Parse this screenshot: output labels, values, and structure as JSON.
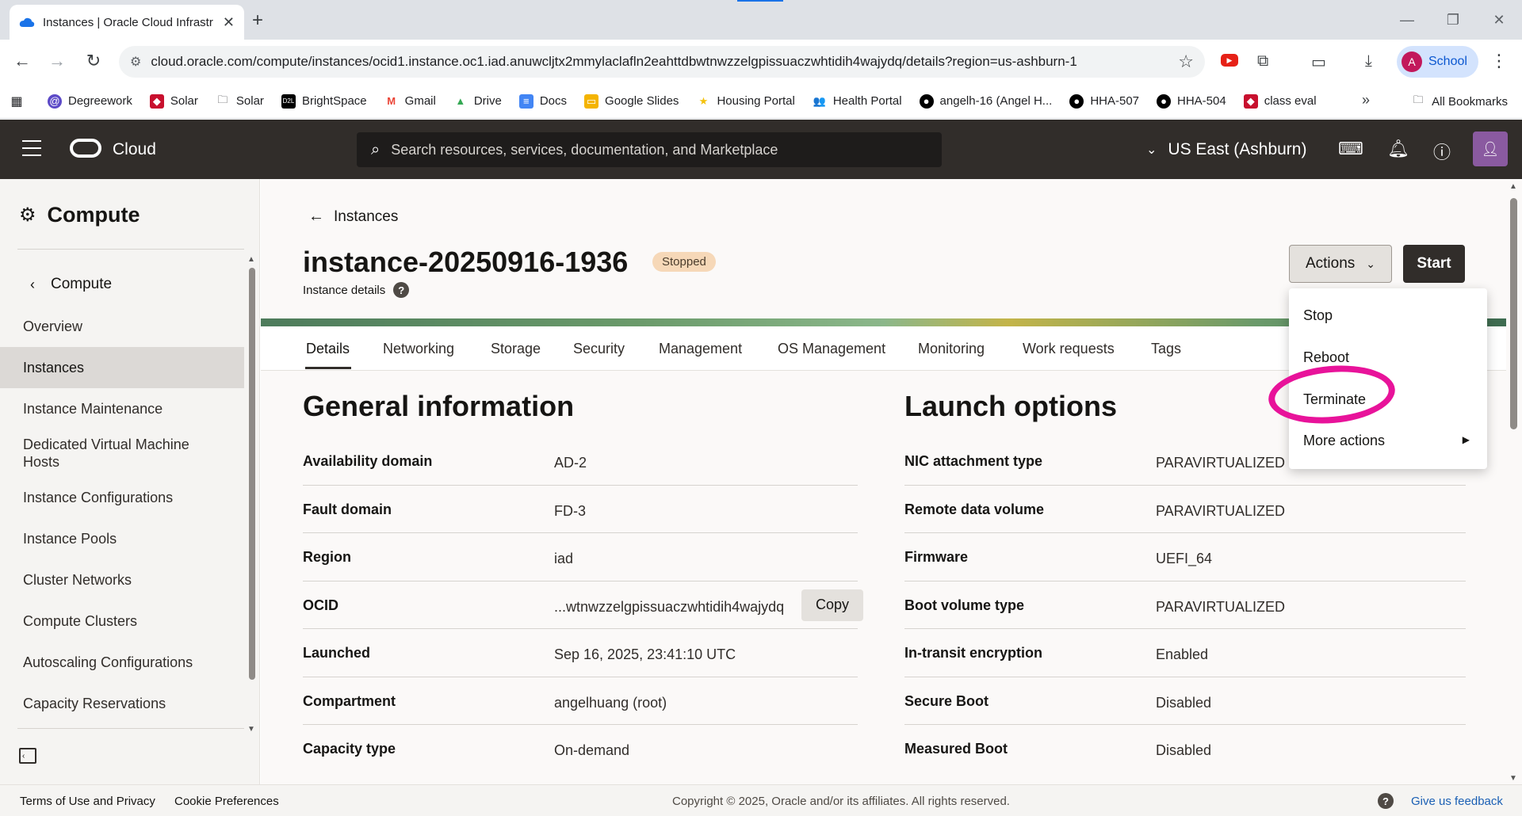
{
  "browser": {
    "tab_title": "Instances | Oracle Cloud Infrastr",
    "url": "cloud.oracle.com/compute/instances/ocid1.instance.oc1.iad.anuwcljtx2mmylaclafln2eahttdbwtnwzzelgpissuaczwhtidih4wajydq/details?region=us-ashburn-1",
    "profile_initial": "A",
    "profile_name": "School",
    "bookmarks": [
      "Degreework",
      "Solar",
      "Solar",
      "BrightSpace",
      "Gmail",
      "Drive",
      "Docs",
      "Google Slides",
      "Housing Portal",
      "Health Portal",
      "angelh-16 (Angel H...",
      "HHA-507",
      "HHA-504",
      "class eval"
    ],
    "all_bookmarks": "All Bookmarks"
  },
  "header": {
    "brand": "Cloud",
    "search_placeholder": "Search resources, services, documentation, and Marketplace",
    "region": "US East (Ashburn)"
  },
  "sidebar": {
    "title": "Compute",
    "back_label": "Compute",
    "items": [
      {
        "label": "Overview",
        "active": false
      },
      {
        "label": "Instances",
        "active": true
      },
      {
        "label": "Instance Maintenance",
        "active": false
      },
      {
        "label": "Dedicated Virtual Machine Hosts",
        "active": false
      },
      {
        "label": "Instance Configurations",
        "active": false
      },
      {
        "label": "Instance Pools",
        "active": false
      },
      {
        "label": "Cluster Networks",
        "active": false
      },
      {
        "label": "Compute Clusters",
        "active": false
      },
      {
        "label": "Autoscaling Configurations",
        "active": false
      },
      {
        "label": "Capacity Reservations",
        "active": false
      }
    ]
  },
  "main": {
    "back_link": "Instances",
    "instance_name": "instance-20250916-1936",
    "status": "Stopped",
    "subtitle": "Instance details",
    "actions_label": "Actions",
    "start_label": "Start",
    "tabs": [
      "Details",
      "Networking",
      "Storage",
      "Security",
      "Management",
      "OS Management",
      "Monitoring",
      "Work requests",
      "Tags"
    ],
    "general": {
      "title": "General information",
      "rows": [
        {
          "key": "Availability domain",
          "value": "AD-2"
        },
        {
          "key": "Fault domain",
          "value": "FD-3"
        },
        {
          "key": "Region",
          "value": "iad"
        },
        {
          "key": "OCID",
          "value": "...wtnwzzelgpissuaczwhtidih4wajydq"
        },
        {
          "key": "Launched",
          "value": "Sep 16, 2025, 23:41:10 UTC"
        },
        {
          "key": "Compartment",
          "value": "angelhuang (root)"
        },
        {
          "key": "Capacity type",
          "value": "On-demand"
        }
      ],
      "copy_label": "Copy"
    },
    "launch": {
      "title": "Launch options",
      "rows": [
        {
          "key": "NIC attachment type",
          "value": "PARAVIRTUALIZED"
        },
        {
          "key": "Remote data volume",
          "value": "PARAVIRTUALIZED"
        },
        {
          "key": "Firmware",
          "value": "UEFI_64"
        },
        {
          "key": "Boot volume type",
          "value": "PARAVIRTUALIZED"
        },
        {
          "key": "In-transit encryption",
          "value": "Enabled"
        },
        {
          "key": "Secure Boot",
          "value": "Disabled"
        },
        {
          "key": "Measured Boot",
          "value": "Disabled"
        }
      ]
    }
  },
  "actions_menu": {
    "items": [
      "Stop",
      "Reboot",
      "Terminate",
      "More actions"
    ],
    "highlight_color": "#e8139a"
  },
  "footer": {
    "terms": "Terms of Use and Privacy",
    "cookies": "Cookie Preferences",
    "copyright": "Copyright © 2025, Oracle and/or its affiliates. All rights reserved.",
    "feedback": "Give us feedback"
  }
}
